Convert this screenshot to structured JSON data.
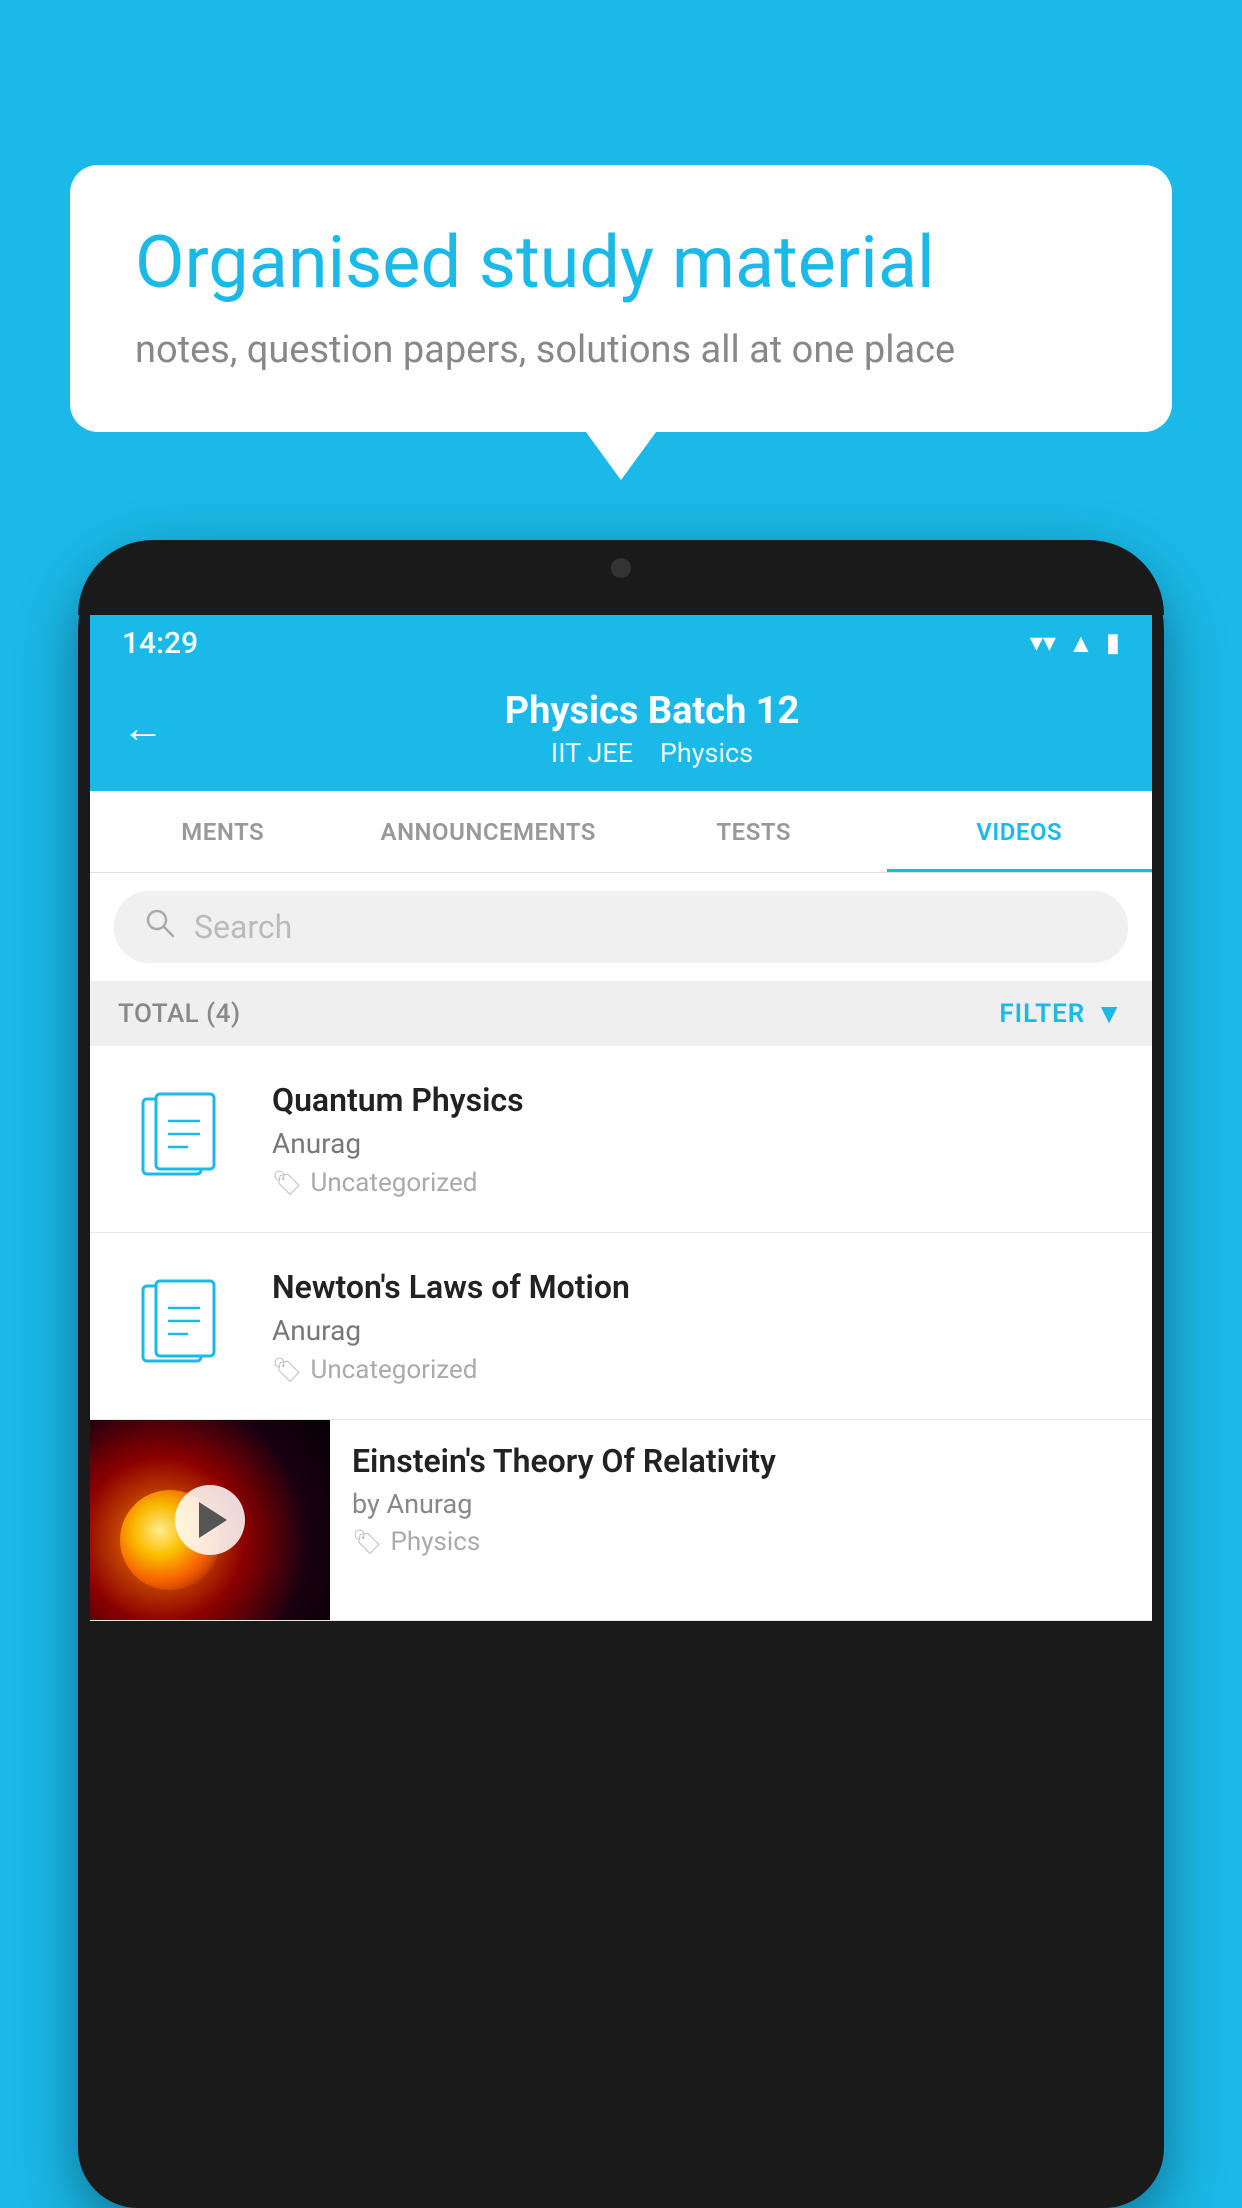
{
  "background": {
    "color": "#1ab9e8"
  },
  "speech_bubble": {
    "heading": "Organised study material",
    "subtext": "notes, question papers, solutions all at one place"
  },
  "phone": {
    "status_bar": {
      "time": "14:29"
    },
    "header": {
      "back_label": "←",
      "title": "Physics Batch 12",
      "subtitle_part1": "IIT JEE",
      "subtitle_part2": "Physics"
    },
    "tabs": [
      {
        "label": "MENTS",
        "active": false
      },
      {
        "label": "ANNOUNCEMENTS",
        "active": false
      },
      {
        "label": "TESTS",
        "active": false
      },
      {
        "label": "VIDEOS",
        "active": true
      }
    ],
    "search": {
      "placeholder": "Search"
    },
    "filter_row": {
      "total_label": "TOTAL (4)",
      "filter_label": "FILTER"
    },
    "videos": [
      {
        "id": 1,
        "title": "Quantum Physics",
        "author": "Anurag",
        "tag": "Uncategorized",
        "has_thumbnail": false
      },
      {
        "id": 2,
        "title": "Newton's Laws of Motion",
        "author": "Anurag",
        "tag": "Uncategorized",
        "has_thumbnail": false
      },
      {
        "id": 3,
        "title": "Einstein's Theory Of Relativity",
        "author_prefix": "by",
        "author": "Anurag",
        "tag": "Physics",
        "has_thumbnail": true
      }
    ]
  }
}
